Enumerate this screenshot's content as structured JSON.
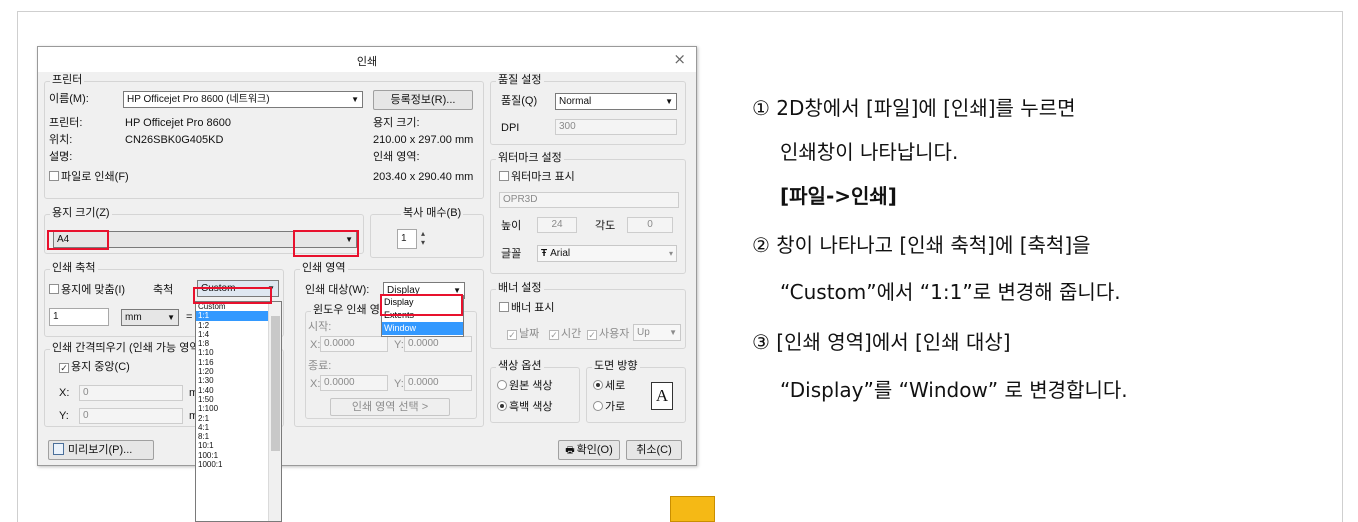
{
  "dialog": {
    "title": "인쇄",
    "close_glyph": "×",
    "printer": {
      "legend": "프린터",
      "name_label": "이름(M):",
      "name_value": "HP Officejet Pro 8600 (네트워크)",
      "properties_button": "등록정보(R)...",
      "printer_label": "프린터:",
      "printer_value": "HP Officejet Pro 8600",
      "location_label": "위치:",
      "location_value": "CN26SBK0G405KD",
      "comment_label": "설명:",
      "print_to_file": "파일로 인쇄(F)",
      "paper_size_label": "용지 크기:",
      "paper_size_value": "210.00 x 297.00 mm",
      "print_area_label": "인쇄 영역:",
      "print_area_value": "203.40 x 290.40 mm"
    },
    "paper": {
      "legend": "용지 크기(Z)",
      "value": "A4"
    },
    "copies": {
      "legend": "복사 매수(B)",
      "value": "1"
    },
    "scale": {
      "legend": "인쇄 축척",
      "fit_to_paper": "용지에 맞춤(I)",
      "scale_label": "축척",
      "scale_value": "Custom",
      "value_field": "1",
      "unit": "mm",
      "equals": "=",
      "options": [
        "Custom",
        "1:1",
        "1:2",
        "1:4",
        "1:8",
        "1:10",
        "1:16",
        "1:20",
        "1:30",
        "1:40",
        "1:50",
        "1:100",
        "2:1",
        "4:1",
        "8:1",
        "10:1",
        "100:1",
        "1000:1"
      ],
      "selected_index": 1
    },
    "margin": {
      "legend": "인쇄 간격띄우기 (인쇄 가능 영역",
      "center": "용지 중앙(C)",
      "x_label": "X:",
      "x_value": "0",
      "y_label": "Y:",
      "y_value": "0",
      "x_unit": "m",
      "y_unit": "m"
    },
    "area": {
      "legend": "인쇄 영역",
      "target_label": "인쇄 대상(W):",
      "target_value": "Display",
      "options": [
        "Display",
        "Extents",
        "Window"
      ],
      "selected_index": 2,
      "window_group": "윈도우 인쇄 영역",
      "start_label": "시작:",
      "end_label": "종료:",
      "x1": "0.0000",
      "y1": "0.0000",
      "x2": "0.0000",
      "y2": "0.0000",
      "x_label": "X:",
      "y_label": "Y:",
      "select_button": "인쇄 영역 선택 >"
    },
    "quality": {
      "legend": "품질 설정",
      "quality_label": "품질(Q)",
      "quality_value": "Normal",
      "dpi_label": "DPI",
      "dpi_value": "300"
    },
    "watermark": {
      "legend": "워터마크 설정",
      "show": "워터마크 표시",
      "text": "OPR3D",
      "height_label": "높이",
      "height_value": "24",
      "angle_label": "각도",
      "angle_value": "0",
      "font_label": "글꼴",
      "font_value": "Arial",
      "font_glyph": "Ŧ"
    },
    "banner": {
      "legend": "배너 설정",
      "show": "배너 표시",
      "date": "날짜",
      "time": "시간",
      "user": "사용자",
      "position": "Up"
    },
    "color": {
      "legend": "색상 옵션",
      "original": "원본 색상",
      "bw": "흑백 색상"
    },
    "orientation": {
      "legend": "도면 방향",
      "portrait": "세로",
      "landscape": "가로",
      "icon_letter": "A"
    },
    "preview_button": "미리보기(P)...",
    "ok_button": "확인(O)",
    "cancel_button": "취소(C)"
  },
  "instructions": {
    "step1_line1": "① 2D창에서 [파일]에 [인쇄]를 누르면",
    "step1_line2": "인쇄창이 나타납니다.",
    "step1_bold": "[파일->인쇄]",
    "step2_line1": "② 창이 나타나고 [인쇄 축척]에 [축척]을",
    "step2_line2": "“Custom”에서 “1:1”로 변경해 줍니다.",
    "step3_line1": "③ [인쇄 영역]에서 [인쇄 대상]",
    "step3_line2": "“Display”를 “Window” 로 변경합니다."
  },
  "colors": {
    "highlight_red": "#e8112d",
    "selection_blue": "#3399ff",
    "marker_orange": "#f5b915"
  }
}
